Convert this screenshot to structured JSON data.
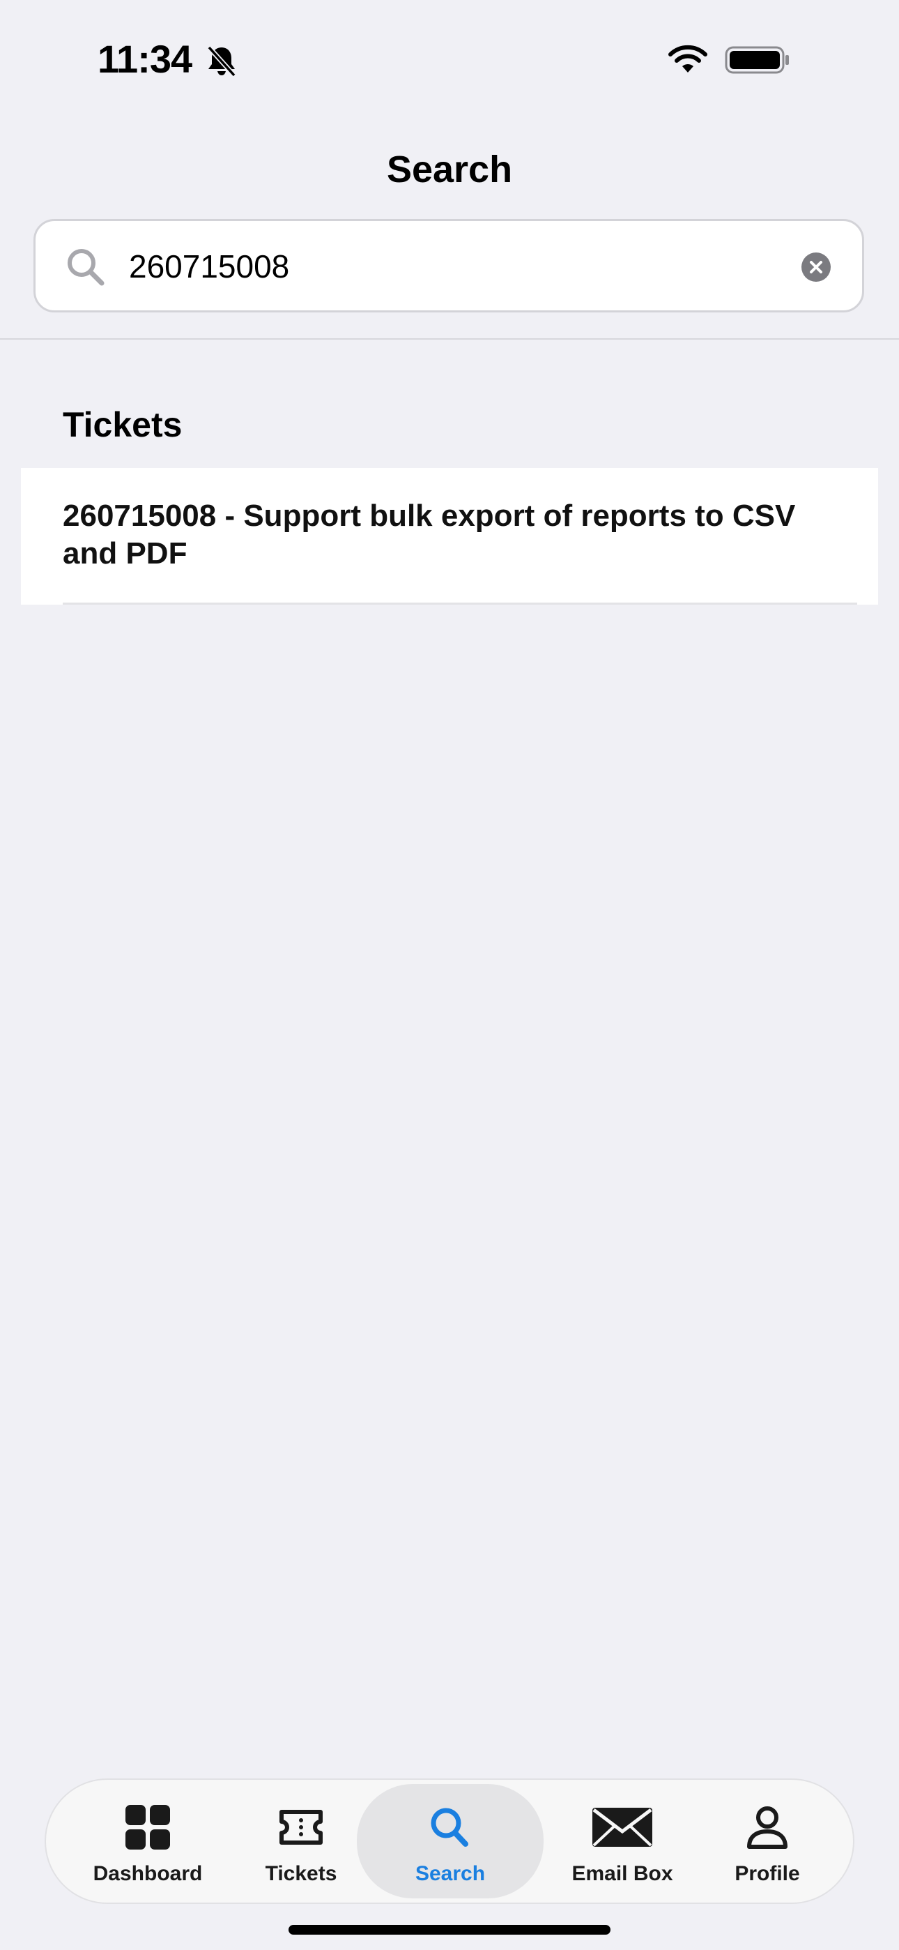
{
  "status_bar": {
    "time": "11:34",
    "icons": [
      "bell-slash-icon",
      "wifi-icon",
      "battery-icon"
    ]
  },
  "header": {
    "title": "Search"
  },
  "search": {
    "value": "260715008",
    "search_icon": "search-icon",
    "clear_icon": "clear-icon"
  },
  "results": {
    "section_title": "Tickets",
    "items": [
      {
        "text": "260715008 - Support bulk export of reports to CSV and PDF"
      }
    ]
  },
  "tab_bar": {
    "active": "Search",
    "accent_color": "#1a7fe0",
    "tabs": [
      {
        "label": "Dashboard",
        "icon": "grid-icon"
      },
      {
        "label": "Tickets",
        "icon": "ticket-icon"
      },
      {
        "label": "Search",
        "icon": "search-icon"
      },
      {
        "label": "Email Box",
        "icon": "envelope-icon"
      },
      {
        "label": "Profile",
        "icon": "person-icon"
      }
    ]
  }
}
